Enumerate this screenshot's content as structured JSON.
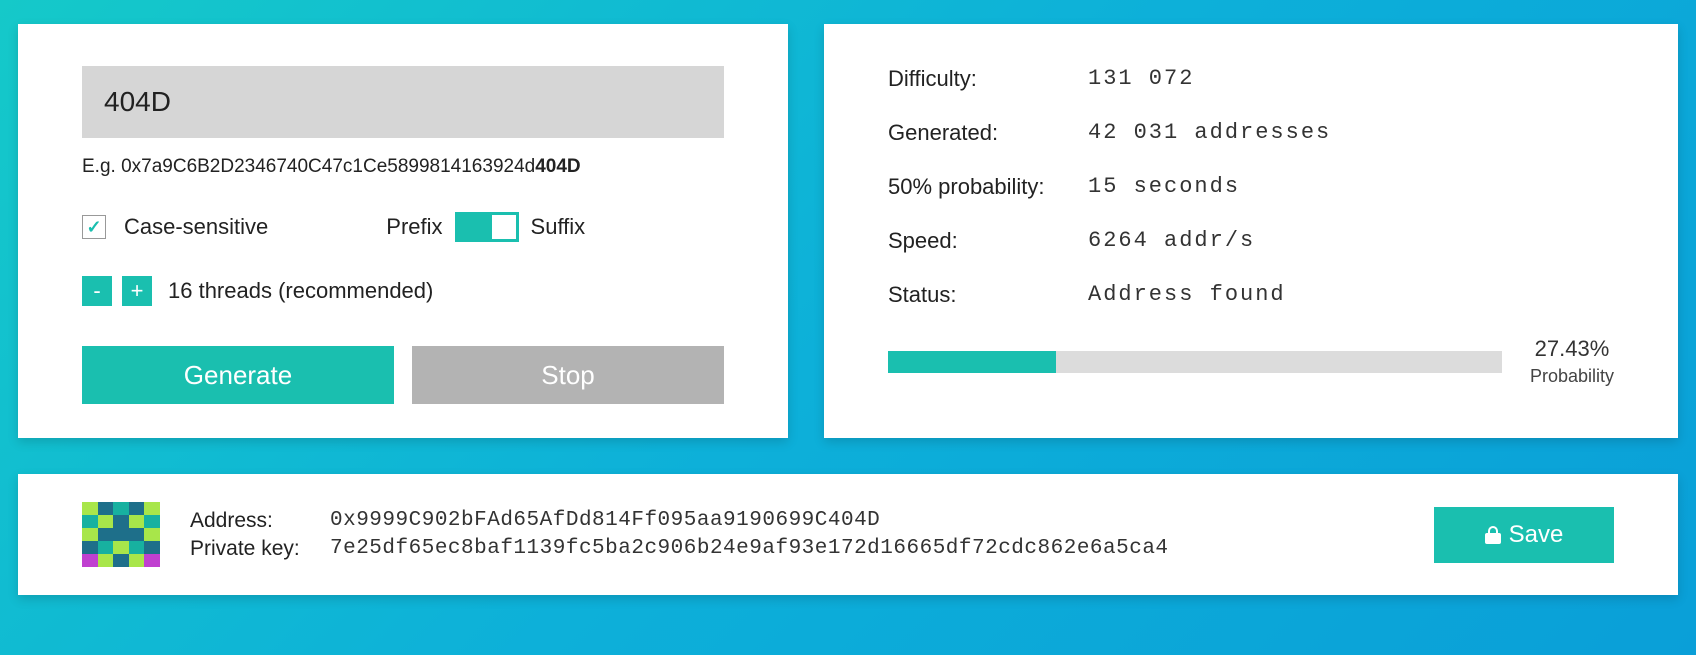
{
  "input": {
    "value": "404D",
    "example_prefix": "E.g. 0x7a9C6B2D2346740C47c1Ce5899814163924d",
    "example_bold": "404D",
    "case_sensitive_label": "Case-sensitive",
    "case_sensitive_checked": true,
    "toggle_prefix_label": "Prefix",
    "toggle_suffix_label": "Suffix",
    "threads_text": "16 threads (recommended)",
    "generate_label": "Generate",
    "stop_label": "Stop"
  },
  "stats": {
    "difficulty_label": "Difficulty:",
    "difficulty_value": "131 072",
    "generated_label": "Generated:",
    "generated_value": "42 031 addresses",
    "fifty_label": "50% probability:",
    "fifty_value": "15 seconds",
    "speed_label": "Speed:",
    "speed_value": "6264 addr/s",
    "status_label": "Status:",
    "status_value": "Address found",
    "probability_percent": "27.43%",
    "probability_label": "Probability",
    "progress_fill_percent": 27.43
  },
  "result": {
    "address_label": "Address:",
    "address_value": "0x9999C902bFAd65AfDd814Ff095aa9190699C404D",
    "private_key_label": "Private key:",
    "private_key_value": "7e25df65ec8baf1139fc5ba2c906b24e9af93e172d16665df72cdc862e6a5ca4",
    "save_label": "Save"
  },
  "colors": {
    "accent": "#1abfaf"
  }
}
